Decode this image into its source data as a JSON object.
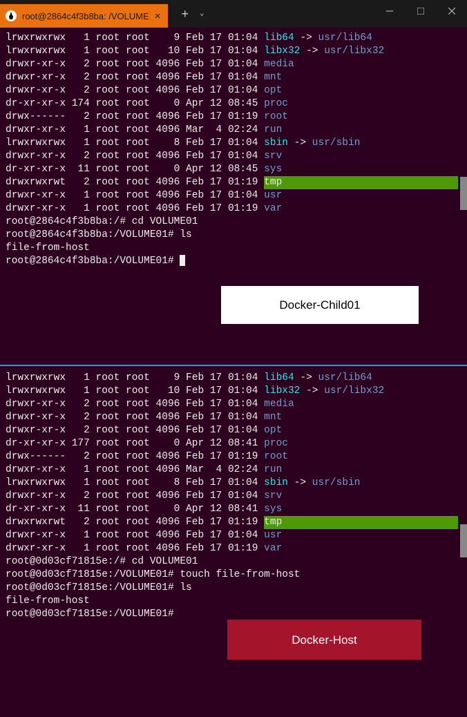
{
  "tab": {
    "title": "root@2864c4f3b8ba: /VOLUME"
  },
  "labels": {
    "child": "Docker-Child01",
    "host": "Docker-Host"
  },
  "paneTop": {
    "listing": [
      {
        "perm": "lrwxrwxrwx",
        "n": "1",
        "u": "root",
        "g": "root",
        "sz": "9",
        "date": "Feb 17 01:04",
        "name": "lib64",
        "arrow": "->",
        "target": "usr/lib64",
        "nc": "cyan",
        "tc": "blue"
      },
      {
        "perm": "lrwxrwxrwx",
        "n": "1",
        "u": "root",
        "g": "root",
        "sz": "10",
        "date": "Feb 17 01:04",
        "name": "libx32",
        "arrow": "->",
        "target": "usr/libx32",
        "nc": "cyan",
        "tc": "blue"
      },
      {
        "perm": "drwxr-xr-x",
        "n": "2",
        "u": "root",
        "g": "root",
        "sz": "4096",
        "date": "Feb 17 01:04",
        "name": "media",
        "nc": "blue"
      },
      {
        "perm": "drwxr-xr-x",
        "n": "2",
        "u": "root",
        "g": "root",
        "sz": "4096",
        "date": "Feb 17 01:04",
        "name": "mnt",
        "nc": "blue"
      },
      {
        "perm": "drwxr-xr-x",
        "n": "2",
        "u": "root",
        "g": "root",
        "sz": "4096",
        "date": "Feb 17 01:04",
        "name": "opt",
        "nc": "blue"
      },
      {
        "perm": "dr-xr-xr-x",
        "n": "174",
        "u": "root",
        "g": "root",
        "sz": "0",
        "date": "Apr 12 08:45",
        "name": "proc",
        "nc": "blue"
      },
      {
        "perm": "drwx------",
        "n": "2",
        "u": "root",
        "g": "root",
        "sz": "4096",
        "date": "Feb 17 01:19",
        "name": "root",
        "nc": "blue"
      },
      {
        "perm": "drwxr-xr-x",
        "n": "1",
        "u": "root",
        "g": "root",
        "sz": "4096",
        "date": "Mar  4 02:24",
        "name": "run",
        "nc": "blue"
      },
      {
        "perm": "lrwxrwxrwx",
        "n": "1",
        "u": "root",
        "g": "root",
        "sz": "8",
        "date": "Feb 17 01:04",
        "name": "sbin",
        "arrow": "->",
        "target": "usr/sbin",
        "nc": "cyan",
        "tc": "blue"
      },
      {
        "perm": "drwxr-xr-x",
        "n": "2",
        "u": "root",
        "g": "root",
        "sz": "4096",
        "date": "Feb 17 01:04",
        "name": "srv",
        "nc": "blue"
      },
      {
        "perm": "dr-xr-xr-x",
        "n": "11",
        "u": "root",
        "g": "root",
        "sz": "0",
        "date": "Apr 12 08:45",
        "name": "sys",
        "nc": "blue"
      },
      {
        "perm": "drwxrwxrwt",
        "n": "2",
        "u": "root",
        "g": "root",
        "sz": "4096",
        "date": "Feb 17 01:19",
        "name": "tmp",
        "nc": "bggreen"
      },
      {
        "perm": "drwxr-xr-x",
        "n": "1",
        "u": "root",
        "g": "root",
        "sz": "4096",
        "date": "Feb 17 01:04",
        "name": "usr",
        "nc": "blue"
      },
      {
        "perm": "drwxr-xr-x",
        "n": "1",
        "u": "root",
        "g": "root",
        "sz": "4096",
        "date": "Feb 17 01:19",
        "name": "var",
        "nc": "blue"
      }
    ],
    "cmds": [
      {
        "prompt": "root@2864c4f3b8ba:/#",
        "text": " cd VOLUME01"
      },
      {
        "prompt": "root@2864c4f3b8ba:/VOLUME01#",
        "text": " ls"
      },
      {
        "plain": "file-from-host"
      },
      {
        "prompt": "root@2864c4f3b8ba:/VOLUME01#",
        "text": " ",
        "cursor": true
      }
    ]
  },
  "paneBottom": {
    "listing": [
      {
        "perm": "lrwxrwxrwx",
        "n": "1",
        "u": "root",
        "g": "root",
        "sz": "9",
        "date": "Feb 17 01:04",
        "name": "lib64",
        "arrow": "->",
        "target": "usr/lib64",
        "nc": "cyan",
        "tc": "blue"
      },
      {
        "perm": "lrwxrwxrwx",
        "n": "1",
        "u": "root",
        "g": "root",
        "sz": "10",
        "date": "Feb 17 01:04",
        "name": "libx32",
        "arrow": "->",
        "target": "usr/libx32",
        "nc": "cyan",
        "tc": "blue"
      },
      {
        "perm": "drwxr-xr-x",
        "n": "2",
        "u": "root",
        "g": "root",
        "sz": "4096",
        "date": "Feb 17 01:04",
        "name": "media",
        "nc": "blue"
      },
      {
        "perm": "drwxr-xr-x",
        "n": "2",
        "u": "root",
        "g": "root",
        "sz": "4096",
        "date": "Feb 17 01:04",
        "name": "mnt",
        "nc": "blue"
      },
      {
        "perm": "drwxr-xr-x",
        "n": "2",
        "u": "root",
        "g": "root",
        "sz": "4096",
        "date": "Feb 17 01:04",
        "name": "opt",
        "nc": "blue"
      },
      {
        "perm": "dr-xr-xr-x",
        "n": "177",
        "u": "root",
        "g": "root",
        "sz": "0",
        "date": "Apr 12 08:41",
        "name": "proc",
        "nc": "blue"
      },
      {
        "perm": "drwx------",
        "n": "2",
        "u": "root",
        "g": "root",
        "sz": "4096",
        "date": "Feb 17 01:19",
        "name": "root",
        "nc": "blue"
      },
      {
        "perm": "drwxr-xr-x",
        "n": "1",
        "u": "root",
        "g": "root",
        "sz": "4096",
        "date": "Mar  4 02:24",
        "name": "run",
        "nc": "blue"
      },
      {
        "perm": "lrwxrwxrwx",
        "n": "1",
        "u": "root",
        "g": "root",
        "sz": "8",
        "date": "Feb 17 01:04",
        "name": "sbin",
        "arrow": "->",
        "target": "usr/sbin",
        "nc": "cyan",
        "tc": "blue"
      },
      {
        "perm": "drwxr-xr-x",
        "n": "2",
        "u": "root",
        "g": "root",
        "sz": "4096",
        "date": "Feb 17 01:04",
        "name": "srv",
        "nc": "blue"
      },
      {
        "perm": "dr-xr-xr-x",
        "n": "11",
        "u": "root",
        "g": "root",
        "sz": "0",
        "date": "Apr 12 08:41",
        "name": "sys",
        "nc": "blue"
      },
      {
        "perm": "drwxrwxrwt",
        "n": "2",
        "u": "root",
        "g": "root",
        "sz": "4096",
        "date": "Feb 17 01:19",
        "name": "tmp",
        "nc": "bggreen"
      },
      {
        "perm": "drwxr-xr-x",
        "n": "1",
        "u": "root",
        "g": "root",
        "sz": "4096",
        "date": "Feb 17 01:04",
        "name": "usr",
        "nc": "blue"
      },
      {
        "perm": "drwxr-xr-x",
        "n": "1",
        "u": "root",
        "g": "root",
        "sz": "4096",
        "date": "Feb 17 01:19",
        "name": "var",
        "nc": "blue"
      }
    ],
    "cmds": [
      {
        "prompt": "root@0d03cf71815e:/#",
        "text": " cd VOLUME01"
      },
      {
        "prompt": "root@0d03cf71815e:/VOLUME01#",
        "text": " touch file-from-host"
      },
      {
        "prompt": "root@0d03cf71815e:/VOLUME01#",
        "text": " ls"
      },
      {
        "plain": "file-from-host"
      },
      {
        "prompt": "root@0d03cf71815e:/VOLUME01#",
        "text": ""
      }
    ]
  }
}
